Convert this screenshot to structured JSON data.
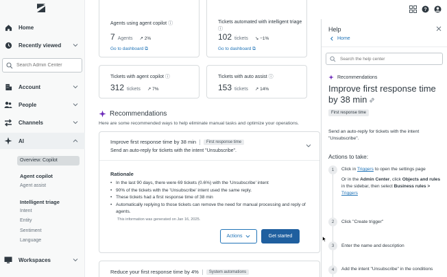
{
  "sidebar": {
    "search_placeholder": "Search Admin Center",
    "items": [
      {
        "label": "Home",
        "icon": "home-icon"
      },
      {
        "label": "Recently viewed",
        "icon": "clock-icon"
      },
      {
        "label": "Account",
        "icon": "building-icon"
      },
      {
        "label": "People",
        "icon": "people-icon"
      },
      {
        "label": "Channels",
        "icon": "arrows-icon"
      },
      {
        "label": "AI",
        "icon": "sparkle-icon"
      },
      {
        "label": "Workspaces",
        "icon": "monitor-icon"
      }
    ],
    "ai_sub": {
      "current": "Overview: Copilot",
      "agent_copilot": "Agent copilot",
      "agent_assist": "Agent assist",
      "intelligent_triage": "Intelligent triage",
      "intent": "Intent",
      "entity": "Entity",
      "sentiment": "Sentiment",
      "language": "Language"
    }
  },
  "metrics": [
    {
      "title": "Agents using agent copilot",
      "value": "7",
      "unit": "Agents",
      "trend": "2%",
      "link": "Go to dashboard"
    },
    {
      "title": "Tickets automated with intelligent triage",
      "value": "102",
      "unit": "tickets",
      "trend": "−1%",
      "link": "Go to dashboard"
    },
    {
      "title": "Tickets with agent copilot",
      "value": "312",
      "unit": "tickets",
      "trend": "7%"
    },
    {
      "title": "Tickets with auto assist",
      "value": "153",
      "unit": "tickets",
      "trend": "14%"
    }
  ],
  "recommendations": {
    "title": "Recommendations",
    "subtitle": "Here are some recommended ways to help eliminate manual tasks and optimize your operations.",
    "card1": {
      "title": "Improve first response time by 38 min",
      "tag": "First response time",
      "desc": "Send an auto-reply for tickets with the intent \"Unsubscribe\".",
      "rationale_label": "Rationale",
      "bullets": [
        "In the last 90 days, there were 69 tickets (0.6%) with the 'Unsubscribe' intent",
        "90% of the tickets with the 'Unsubscribe' intent used the same reply.",
        "These tickets had a first response time of 38 min",
        "Automatically replying to those tickets can remove the need for manual processing and reply of agents."
      ],
      "generated": "This information was generated on Jan 16, 2025.",
      "actions_label": "Actions",
      "start_label": "Get started"
    },
    "card2": {
      "title": "Reduce your first response time by 4%",
      "tag": "System automations"
    }
  },
  "help": {
    "title": "Help",
    "home": "Home",
    "search_placeholder": "Search the help center",
    "category": "Recommendations",
    "heading": "Improve first response time by 38 min",
    "tag": "First response time",
    "intro": "Send an auto-reply for tickets with the intent \"Unsubscribe\".",
    "actions_heading": "Actions to take:",
    "steps": [
      {
        "num": "1",
        "a": "Click in ",
        "link": "Triggers",
        "b": " to open the settings page",
        "c": "Or in the ",
        "d": "Admin Center",
        "e": ", click ",
        "f": "Objects and rules",
        "g": " in the sidebar, then select ",
        "h": "Business rules > ",
        "link2": "Triggers"
      },
      {
        "num": "2",
        "text": "Click \"Create trigger\""
      },
      {
        "num": "3",
        "text": "Enter the name and description"
      },
      {
        "num": "4",
        "text": "Add the intent \"Unsubscribe\" in the conditions"
      }
    ]
  },
  "colors": {
    "accent": "#1f73b7",
    "primary_button": "#1f5f9f",
    "sidebar_bg": "#f8f9f9"
  }
}
